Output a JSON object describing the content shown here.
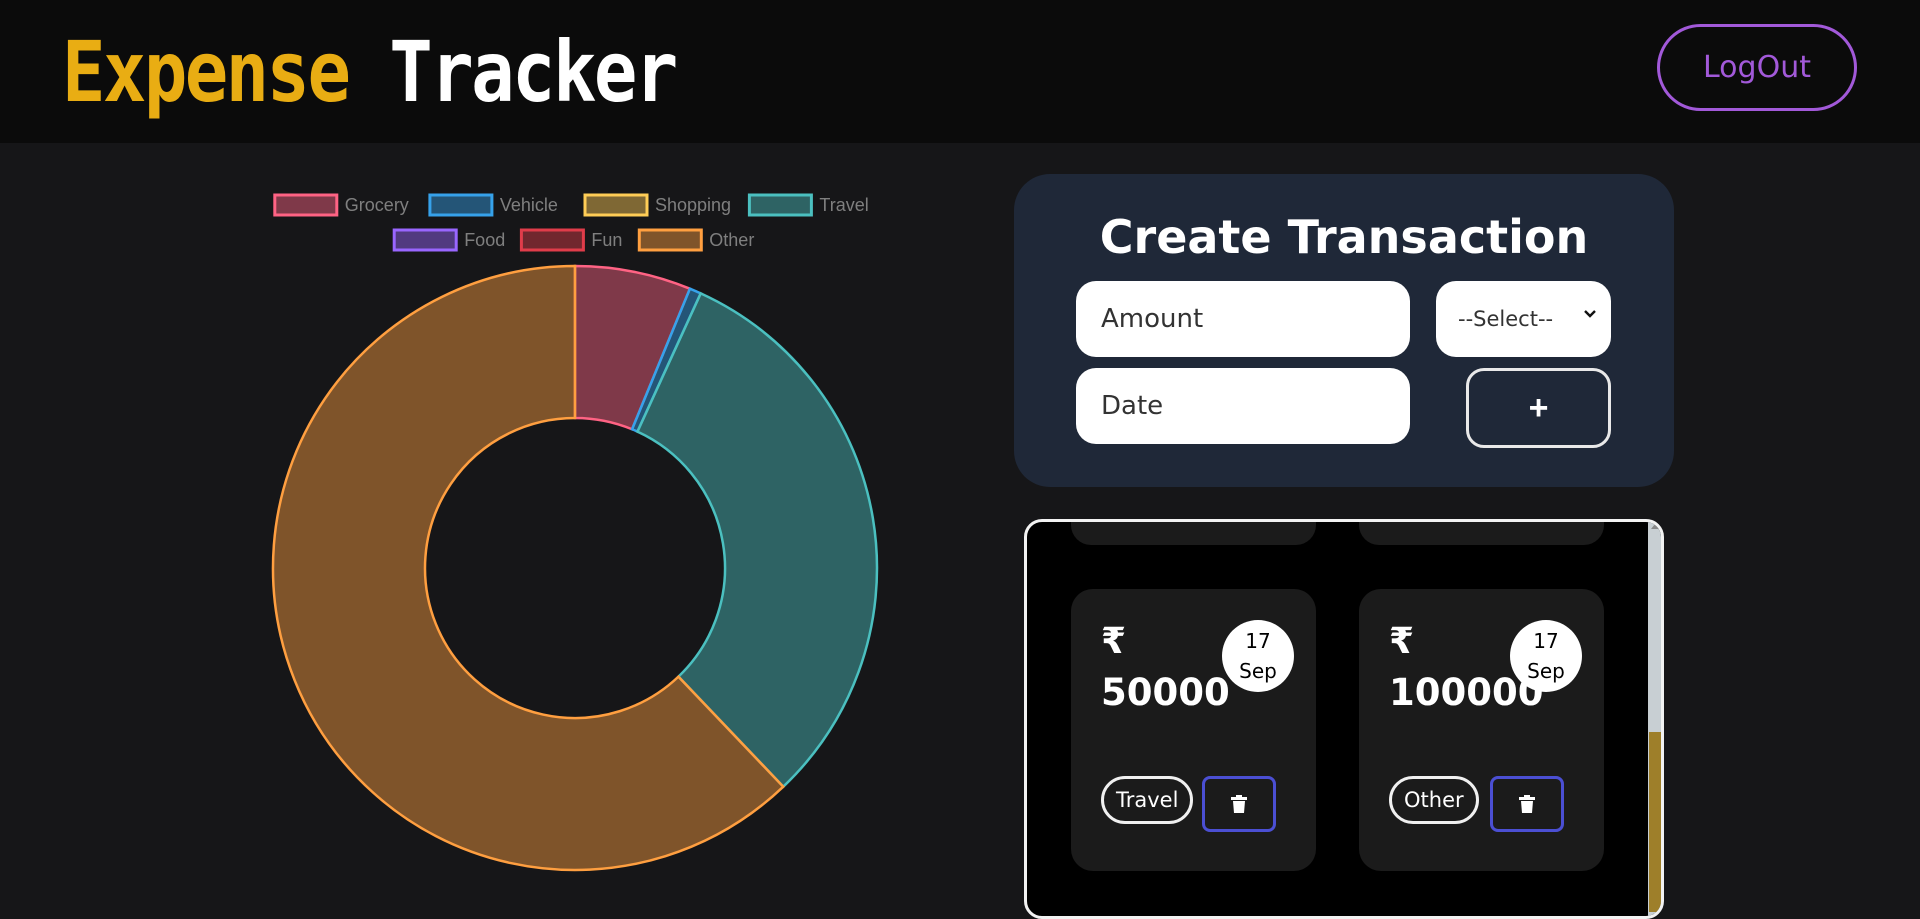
{
  "header": {
    "brand_part1": "Expense",
    "brand_part2": "Tracker",
    "logout_label": "LogOut"
  },
  "colors": {
    "brand_yellow": "#e9ad13",
    "logout_purple": "#a259d9",
    "card_panel": "#1f2838",
    "delete_border": "#4b4fd3"
  },
  "chart_data": {
    "type": "pie",
    "variant": "doughnut",
    "legend_position": "top",
    "legend": [
      "Grocery",
      "Vehicle",
      "Shopping",
      "Travel",
      "Food",
      "Fun",
      "Other"
    ],
    "series": [
      {
        "name": "Grocery",
        "value": 10000,
        "color": "#ff6384"
      },
      {
        "name": "Vehicle",
        "value": 1000,
        "color": "#36a2eb"
      },
      {
        "name": "Shopping",
        "value": 0,
        "color": "#ffcd56"
      },
      {
        "name": "Travel",
        "value": 50000,
        "color": "#4bc0c0"
      },
      {
        "name": "Food",
        "value": 0,
        "color": "#9966ff"
      },
      {
        "name": "Fun",
        "value": 0,
        "color": "#e03c4a"
      },
      {
        "name": "Other",
        "value": 100000,
        "color": "#ff9f40"
      }
    ]
  },
  "create_form": {
    "title": "Create Transaction",
    "amount_placeholder": "Amount",
    "date_placeholder": "Date",
    "select_value": "--Select--",
    "add_label": "+"
  },
  "transactions": [
    {
      "currency": "₹",
      "amount": "50000",
      "day": "17",
      "month": "Sep",
      "category": "Travel"
    },
    {
      "currency": "₹",
      "amount": "100000",
      "day": "17",
      "month": "Sep",
      "category": "Other"
    }
  ]
}
